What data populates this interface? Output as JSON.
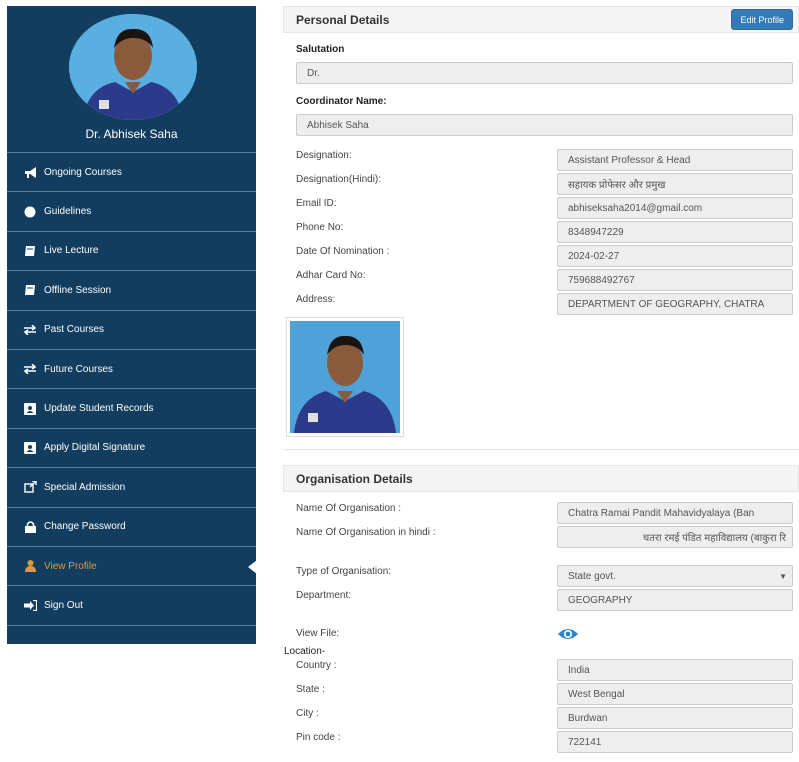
{
  "sidebar": {
    "profile_name": "Dr. Abhisek Saha",
    "items": [
      {
        "label": "Ongoing Courses",
        "icon": "bullhorn-icon"
      },
      {
        "label": "Guidelines",
        "icon": "gear-icon"
      },
      {
        "label": "Live Lecture",
        "icon": "book-icon"
      },
      {
        "label": "Offline Session",
        "icon": "book-icon"
      },
      {
        "label": "Past Courses",
        "icon": "exchange-icon"
      },
      {
        "label": "Future Courses",
        "icon": "exchange-icon"
      },
      {
        "label": "Update Student Records",
        "icon": "contact-card-icon"
      },
      {
        "label": "Apply Digital Signature",
        "icon": "contact-card-icon"
      },
      {
        "label": "Special Admission",
        "icon": "external-link-icon"
      },
      {
        "label": "Change Password",
        "icon": "lock-icon"
      },
      {
        "label": "View Profile",
        "icon": "user-icon"
      },
      {
        "label": "Sign Out",
        "icon": "sign-out-icon"
      }
    ],
    "active_color": "#e09a3a",
    "bg_color": "#123d5e"
  },
  "personal": {
    "title": "Personal Details",
    "edit_label": "Edit Profile",
    "salutation_label": "Salutation",
    "salutation_value": "Dr.",
    "coordinator_label": "Coordinator Name:",
    "coordinator_value": "Abhisek Saha",
    "fields": [
      {
        "label": "Designation:",
        "value": "Assistant Professor & Head"
      },
      {
        "label": "Designation(Hindi):",
        "value": "सहायक प्रोफेसर और प्रमुख"
      },
      {
        "label": "Email ID:",
        "value": "abhiseksaha2014@gmail.com"
      },
      {
        "label": "Phone No:",
        "value": "8348947229"
      },
      {
        "label": "Date Of Nomination :",
        "value": "2024-02-27"
      },
      {
        "label": "Adhar Card No:",
        "value": "759688492767"
      },
      {
        "label": "Address:",
        "value": "DEPARTMENT OF GEOGRAPHY, CHATRA"
      }
    ]
  },
  "organisation": {
    "title": "Organisation Details",
    "name_label": "Name Of Organisation :",
    "name_value": "Chatra Ramai Pandit Mahavidyalaya (Ban",
    "name_hindi_label": "Name Of Organisation in hindi :",
    "name_hindi_value": "चतरा रमई पंडित महाविद्यालय (बाकुरा रि",
    "type_label": "Type of Organisation:",
    "type_value": "State govt.",
    "department_label": "Department:",
    "department_value": "GEOGRAPHY",
    "view_file_label": "View File:",
    "location_label": "Location-",
    "country_label": "Country :",
    "country_value": "India",
    "state_label": "State :",
    "state_value": "West Bengal",
    "city_label": "City :",
    "city_value": "Burdwan",
    "pin_label": "Pin code :",
    "pin_value": "722141"
  },
  "colors": {
    "primary_button": "#337ab7",
    "eye_icon": "#2a86c8"
  }
}
